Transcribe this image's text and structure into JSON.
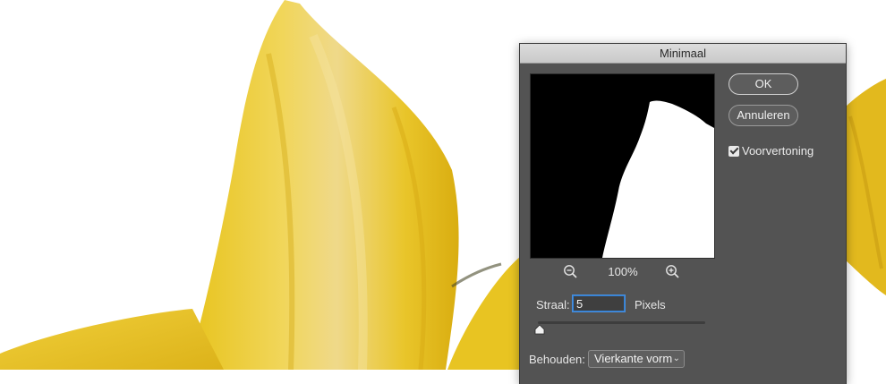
{
  "dialog": {
    "title": "Minimaal",
    "ok_label": "OK",
    "cancel_label": "Annuleren",
    "preview_checkbox": {
      "label": "Voorvertoning",
      "checked": true
    },
    "zoom": {
      "level": "100%"
    },
    "radius": {
      "label": "Straal:",
      "value": "5",
      "unit": "Pixels",
      "slider_fraction": 0.01
    },
    "preserve": {
      "label": "Behouden:",
      "selected": "Vierkante vorm"
    }
  },
  "icons": {
    "zoom_out": "zoom-out-icon",
    "zoom_in": "zoom-in-icon",
    "chevron": "chevron-down-icon",
    "check": "checkmark-icon"
  },
  "colors": {
    "dialog_bg": "#535353",
    "titlebar": "#d3d3d3",
    "focus": "#2f7fd6",
    "petal_yellow": "#e8c31e"
  }
}
